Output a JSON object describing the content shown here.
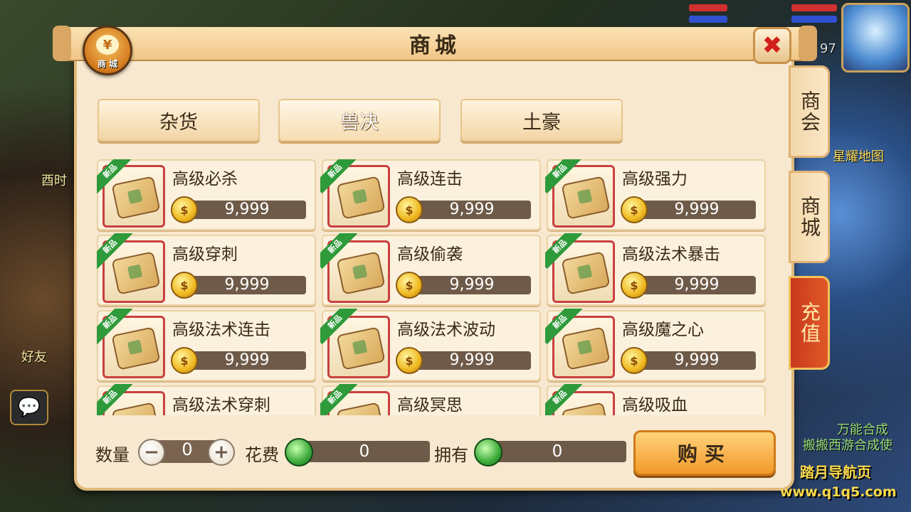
{
  "window": {
    "title": "商城",
    "badge_label": "商 城",
    "badge_coin": "¥",
    "close_glyph": "✖"
  },
  "categories": [
    {
      "label": "杂货",
      "active": false
    },
    {
      "label": "兽决",
      "active": true
    },
    {
      "label": "土豪",
      "active": false
    }
  ],
  "side_tabs": [
    {
      "label": "商会"
    },
    {
      "label": "商城"
    },
    {
      "label": "充值"
    }
  ],
  "new_badge": "新品",
  "items": [
    {
      "name": "高级必杀",
      "price": "9,999"
    },
    {
      "name": "高级连击",
      "price": "9,999"
    },
    {
      "name": "高级强力",
      "price": "9,999"
    },
    {
      "name": "高级穿刺",
      "price": "9,999"
    },
    {
      "name": "高级偷袭",
      "price": "9,999"
    },
    {
      "name": "高级法术暴击",
      "price": "9,999"
    },
    {
      "name": "高级法术连击",
      "price": "9,999"
    },
    {
      "name": "高级法术波动",
      "price": "9,999"
    },
    {
      "name": "高级魔之心",
      "price": "9,999"
    },
    {
      "name": "高级法术穿刺",
      "price": ""
    },
    {
      "name": "高级冥思",
      "price": ""
    },
    {
      "name": "高级吸血",
      "price": ""
    }
  ],
  "purchase": {
    "quantity_label": "数量",
    "quantity": "0",
    "cost_label": "花费",
    "cost": "0",
    "owned_label": "拥有",
    "owned": "0",
    "buy_label": "购买"
  },
  "background": {
    "left_texts": [
      "酉时",
      "好友"
    ],
    "right_texts": [
      "星耀地图",
      "万能合成",
      "搬搬西游合成使"
    ],
    "level": "97"
  },
  "watermark": {
    "line1": "踏月导航页",
    "line2": "www.q1q5.com"
  },
  "colors": {
    "panel_bg": "#f7e8cf",
    "accent_red": "#c94040",
    "new_green": "#2e9a3a",
    "buy_orange": "#f29a2a"
  }
}
